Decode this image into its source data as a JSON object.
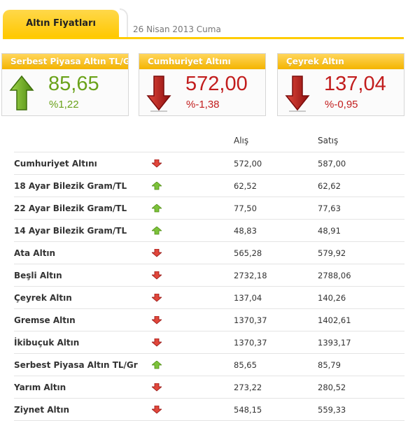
{
  "header": {
    "tab_label": "Altın Fiyatları",
    "date": "26 Nisan 2013 Cuma"
  },
  "cards": [
    {
      "title": "Serbest Piyasa Altın TL/Gr",
      "value": "85,65",
      "change": "%1,22",
      "direction": "up",
      "icon": "arrow-up-icon"
    },
    {
      "title": "Cumhuriyet Altını",
      "value": "572,00",
      "change": "%-1,38",
      "direction": "down",
      "icon": "arrow-down-icon"
    },
    {
      "title": "Çeyrek Altın",
      "value": "137,04",
      "change": "%-0,95",
      "direction": "down",
      "icon": "arrow-down-icon"
    }
  ],
  "table": {
    "columns": {
      "buy": "Alış",
      "sell": "Satış"
    },
    "rows": [
      {
        "name": "Cumhuriyet Altını",
        "direction": "down",
        "buy": "572,00",
        "sell": "587,00"
      },
      {
        "name": "18 Ayar Bilezik Gram/TL",
        "direction": "up",
        "buy": "62,52",
        "sell": "62,62"
      },
      {
        "name": "22 Ayar Bilezik Gram/TL",
        "direction": "up",
        "buy": "77,50",
        "sell": "77,63"
      },
      {
        "name": "14 Ayar Bilezik Gram/TL",
        "direction": "up",
        "buy": "48,83",
        "sell": "48,91"
      },
      {
        "name": "Ata Altın",
        "direction": "down",
        "buy": "565,28",
        "sell": "579,92"
      },
      {
        "name": "Beşli Altın",
        "direction": "down",
        "buy": "2732,18",
        "sell": "2788,06"
      },
      {
        "name": "Çeyrek Altın",
        "direction": "down",
        "buy": "137,04",
        "sell": "140,26"
      },
      {
        "name": "Gremse Altın",
        "direction": "down",
        "buy": "1370,37",
        "sell": "1402,61"
      },
      {
        "name": "İkibuçuk Altın",
        "direction": "down",
        "buy": "1370,37",
        "sell": "1393,17"
      },
      {
        "name": "Serbest Piyasa Altın TL/Gr",
        "direction": "up",
        "buy": "85,65",
        "sell": "85,79"
      },
      {
        "name": "Yarım Altın",
        "direction": "down",
        "buy": "273,22",
        "sell": "280,52"
      },
      {
        "name": "Ziynet Altın",
        "direction": "down",
        "buy": "548,15",
        "sell": "559,33"
      }
    ]
  },
  "colors": {
    "accent": "#ffcc00",
    "up": "#6aa21a",
    "down": "#c21d1d"
  }
}
